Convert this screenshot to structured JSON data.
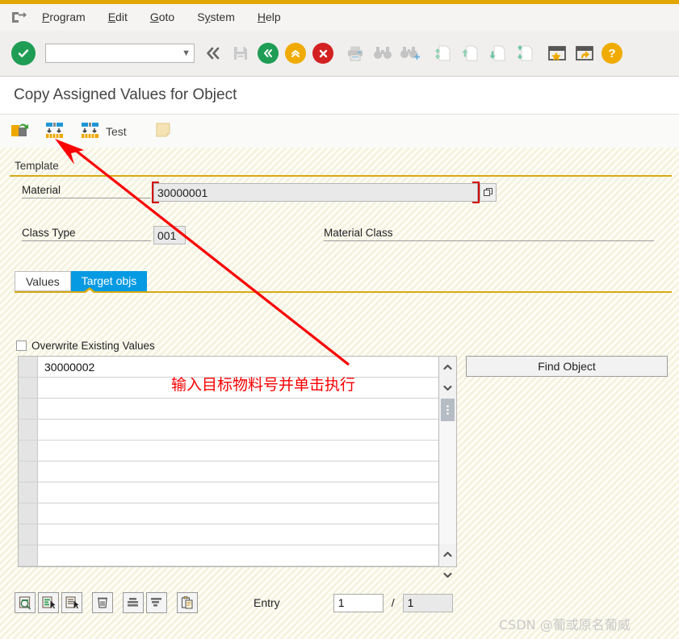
{
  "window": {
    "system_icon": "exit-arrow-icon",
    "accent_gold": "#e3a600"
  },
  "menubar": {
    "items": [
      {
        "label": "Program",
        "accel": "P"
      },
      {
        "label": "Edit",
        "accel": "E"
      },
      {
        "label": "Goto",
        "accel": "G"
      },
      {
        "label": "System",
        "accel": "y"
      },
      {
        "label": "Help",
        "accel": "H"
      }
    ]
  },
  "toolbar": {
    "enter_label": "✔",
    "command_field": {
      "value": "",
      "placeholder": ""
    },
    "icons": [
      {
        "name": "back-double-icon",
        "glyph": "«"
      },
      {
        "name": "save-icon",
        "glyph": "save"
      },
      {
        "name": "back-icon",
        "glyph": "«"
      },
      {
        "name": "exit-icon",
        "glyph": "⌃"
      },
      {
        "name": "cancel-icon",
        "glyph": "✕"
      },
      {
        "name": "print-icon",
        "glyph": "print"
      },
      {
        "name": "find-icon",
        "glyph": "find"
      },
      {
        "name": "find-next-icon",
        "glyph": "find+"
      },
      {
        "name": "first-page-icon",
        "glyph": "⇈"
      },
      {
        "name": "previous-page-icon",
        "glyph": "↑"
      },
      {
        "name": "next-page-icon",
        "glyph": "↓"
      },
      {
        "name": "last-page-icon",
        "glyph": "⇊"
      },
      {
        "name": "create-session-icon",
        "glyph": "★"
      },
      {
        "name": "shortcut-icon",
        "glyph": "↰"
      },
      {
        "name": "help-icon",
        "glyph": "?"
      }
    ]
  },
  "title": "Copy Assigned Values for Object",
  "app_toolbar": {
    "buttons": [
      {
        "name": "copy-object-button",
        "label": "",
        "icon": "copy-transfer-icon"
      },
      {
        "name": "execute-copy-button",
        "label": "",
        "icon": "copy-values-icon"
      },
      {
        "name": "test-button",
        "label": "Test",
        "icon": "copy-values-test-icon"
      },
      {
        "name": "notes-button",
        "label": "",
        "icon": "note-icon"
      }
    ]
  },
  "template_group": {
    "title": "Template",
    "material": {
      "label": "Material",
      "value": "30000001"
    },
    "class_type": {
      "label": "Class Type",
      "value": "001"
    },
    "material_class": {
      "label": "Material Class",
      "value": ""
    }
  },
  "tabs": [
    {
      "label": "Values",
      "active": false
    },
    {
      "label": "Target objs",
      "active": true
    }
  ],
  "overwrite_checkbox": {
    "label": "Overwrite Existing Values",
    "checked": false
  },
  "target_table": {
    "rows": [
      {
        "value": "30000002"
      },
      {
        "value": ""
      },
      {
        "value": ""
      },
      {
        "value": ""
      },
      {
        "value": ""
      },
      {
        "value": ""
      },
      {
        "value": ""
      },
      {
        "value": ""
      },
      {
        "value": ""
      },
      {
        "value": ""
      }
    ]
  },
  "find_object_button": {
    "label": "Find Object"
  },
  "bottom_toolbar": {
    "buttons": [
      {
        "name": "check-entries-button",
        "icon": "list-search-icon"
      },
      {
        "name": "insert-row-button",
        "icon": "list-insert-icon"
      },
      {
        "name": "delete-row-button",
        "icon": "list-delete-row-icon"
      },
      {
        "name": "delete-button",
        "icon": "trash-icon"
      },
      {
        "name": "sort-ascending-button",
        "icon": "sort-ascending-icon"
      },
      {
        "name": "sort-descending-button",
        "icon": "sort-descending-icon"
      },
      {
        "name": "paste-button",
        "icon": "clipboard-icon"
      }
    ],
    "entry_label": "Entry",
    "entry_current": "1",
    "separator": "/",
    "entry_total": "1"
  },
  "annotations": {
    "note_text": "输入目标物料号并单击执行",
    "arrow_color": "#fa0000"
  },
  "watermark": "CSDN @葡或原名葡威"
}
